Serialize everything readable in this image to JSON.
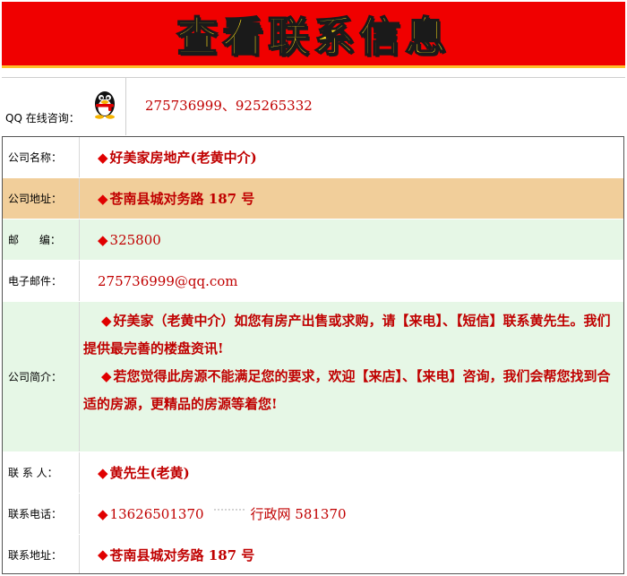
{
  "banner": {
    "title": "查看联系信息"
  },
  "qq": {
    "label": "QQ 在线咨询：",
    "icon": "qq-penguin-icon",
    "numbers": "275736999、925265332"
  },
  "rows": {
    "company_name": {
      "label": "公司名称：",
      "value": "好美家房地产(老黄中介)"
    },
    "company_address": {
      "label": "公司地址：",
      "value": "苍南县城对务路 187 号"
    },
    "postcode": {
      "label": "邮      编：",
      "value": "325800"
    },
    "email": {
      "label": "电子邮件：",
      "value": "275736999@qq.com"
    },
    "intro": {
      "label": "公司简介：",
      "paragraph1": "好美家（老黄中介）如您有房产出售或求购，请【来电】、【短信】联系黄先生。我们提供最完善的楼盘资讯!",
      "paragraph2": "若您觉得此房源不能满足您的要求，欢迎【来店】、【来电】咨询，我们会帮您找到合适的房源，更精品的房源等着您!"
    },
    "contact_person": {
      "label": "联 系 人：",
      "value": "黄先生(老黄)"
    },
    "contact_phone": {
      "label": "联系电话：",
      "value": "13626501370",
      "dots": "˙˙˙˙˙˙˙˙˙",
      "extra": "行政网 581370"
    },
    "contact_address": {
      "label": "联系地址：",
      "value": "苍南县城对务路 187 号"
    }
  },
  "bullet": "◆",
  "colors": {
    "banner_bg": "#f00000",
    "banner_text": "#ffe01a",
    "value_text": "#c00000",
    "tan_row": "#f1ce9a",
    "green_row": "#e6f7e6"
  }
}
